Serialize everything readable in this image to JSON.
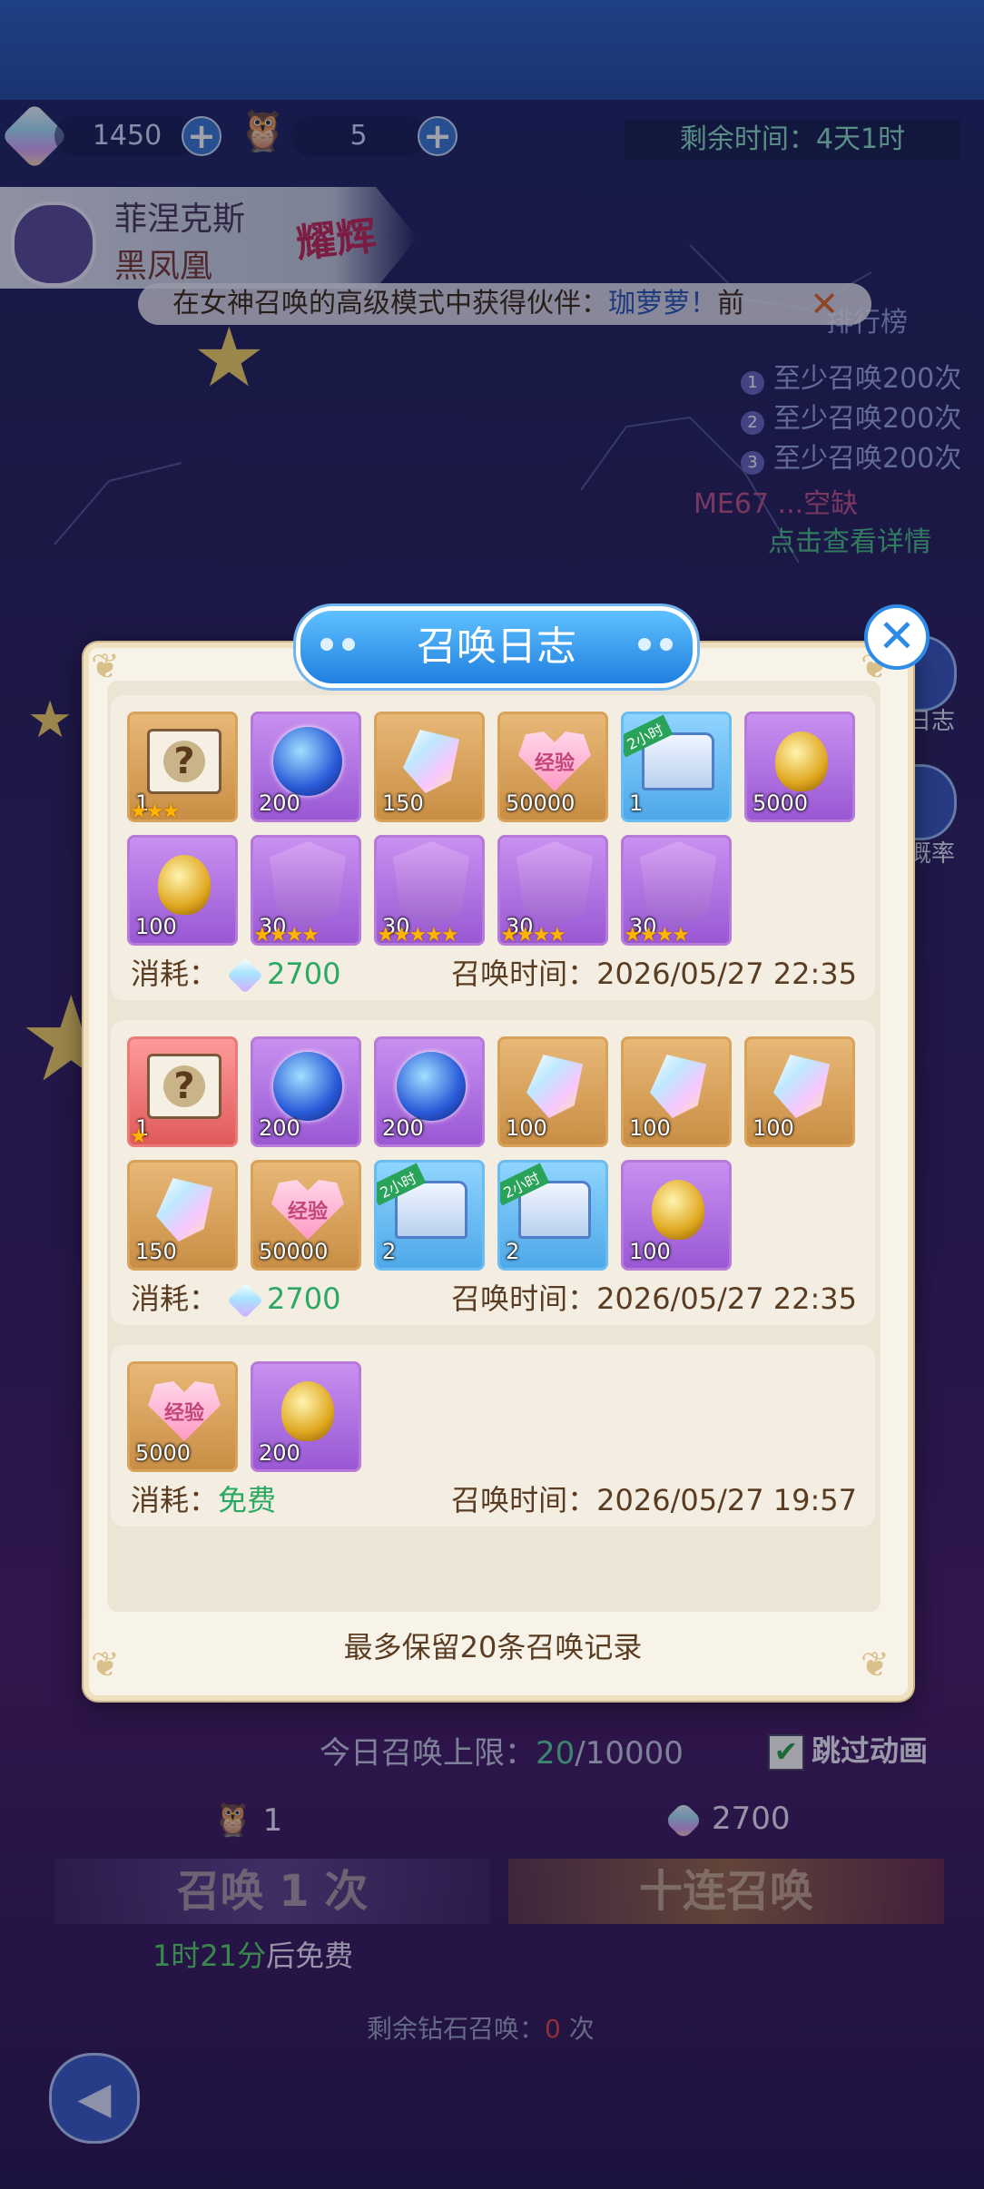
{
  "resources": {
    "gems": "1450",
    "tickets": "5"
  },
  "timer": "剩余时间：4天1时",
  "hero": {
    "name": "菲涅克斯",
    "subtitle": "黑凤凰",
    "tier": "耀辉"
  },
  "marquee": {
    "prefix": "在女神召唤的高级模式中获得伙伴：",
    "highlight": "珈萝萝！",
    "suffix": "前"
  },
  "ranking": {
    "title": "排行榜",
    "items": [
      {
        "num": "1",
        "text": "至少召唤200次"
      },
      {
        "num": "2",
        "text": "至少召唤200次"
      },
      {
        "num": "3",
        "text": "至少召唤200次"
      }
    ],
    "me": "ME67 ...空缺",
    "details_link": "点击查看详情"
  },
  "side": {
    "log": "日志",
    "rate": "概率"
  },
  "modal": {
    "title": "召唤日志",
    "cost_label": "消耗：",
    "time_label": "召唤时间：",
    "records": [
      {
        "items": [
          {
            "icon": "mystery-box-icon",
            "bg": "gold",
            "qty": "1",
            "stars": "★★★"
          },
          {
            "icon": "crystal-orb-icon",
            "bg": "purple",
            "qty": "200"
          },
          {
            "icon": "crystal-icon",
            "bg": "gold",
            "qty": "150"
          },
          {
            "icon": "exp-heart-icon",
            "bg": "gold",
            "qty": "50000"
          },
          {
            "icon": "treasure-chest-icon",
            "bg": "blue",
            "qty": "1",
            "tag": "2小时"
          },
          {
            "icon": "golden-egg-icon",
            "bg": "purple",
            "qty": "5000"
          },
          {
            "icon": "golden-egg-icon",
            "bg": "purple",
            "qty": "100"
          },
          {
            "icon": "hero-shard-icon",
            "bg": "purple",
            "qty": "30",
            "stars": "★★★★"
          },
          {
            "icon": "hero-shard-icon",
            "bg": "purple",
            "qty": "30",
            "stars": "★★★★★"
          },
          {
            "icon": "hero-shard-icon",
            "bg": "purple",
            "qty": "30",
            "stars": "★★★★"
          },
          {
            "icon": "hero-shard-icon",
            "bg": "purple",
            "qty": "30",
            "stars": "★★★★"
          }
        ],
        "cost": "2700",
        "time": "2026/05/27 22:35"
      },
      {
        "items": [
          {
            "icon": "mystery-box-icon",
            "bg": "red",
            "qty": "1",
            "stars": "★"
          },
          {
            "icon": "crystal-orb-icon",
            "bg": "purple",
            "qty": "200"
          },
          {
            "icon": "crystal-orb-icon",
            "bg": "purple",
            "qty": "200"
          },
          {
            "icon": "crystal-icon",
            "bg": "gold",
            "qty": "100"
          },
          {
            "icon": "crystal-icon",
            "bg": "gold",
            "qty": "100"
          },
          {
            "icon": "crystal-icon",
            "bg": "gold",
            "qty": "100"
          },
          {
            "icon": "crystal-icon",
            "bg": "gold",
            "qty": "150"
          },
          {
            "icon": "exp-heart-icon",
            "bg": "gold",
            "qty": "50000"
          },
          {
            "icon": "treasure-chest-icon",
            "bg": "blue",
            "qty": "2",
            "tag": "2小时"
          },
          {
            "icon": "treasure-chest-icon",
            "bg": "blue",
            "qty": "2",
            "tag": "2小时"
          },
          {
            "icon": "golden-egg-icon",
            "bg": "purple",
            "qty": "100"
          }
        ],
        "cost": "2700",
        "time": "2026/05/27 22:35"
      },
      {
        "items": [
          {
            "icon": "exp-heart-icon",
            "bg": "gold",
            "qty": "5000"
          },
          {
            "icon": "golden-egg-icon",
            "bg": "purple",
            "qty": "200"
          }
        ],
        "cost_free": "免费",
        "time": "2026/05/27 19:57"
      }
    ],
    "exp_text": "经验",
    "footer": "最多保留20条召唤记录"
  },
  "summon": {
    "limit_label": "今日召唤上限：",
    "limit_used": "20",
    "limit_total": "/10000",
    "skip_label": "跳过动画",
    "single_cost": "1",
    "ten_cost": "2700",
    "single_label": "召唤 1 次",
    "ten_label": "十连召唤",
    "free_timer": "1时21分",
    "free_suffix": "后免费",
    "remain_prefix": "剩余钻石召唤：",
    "remain_count": "0",
    "remain_suffix": "次"
  },
  "colors": {
    "accent_blue": "#2d8ae6",
    "free_green": "#2ba862",
    "panel": "#f8f3e8"
  }
}
